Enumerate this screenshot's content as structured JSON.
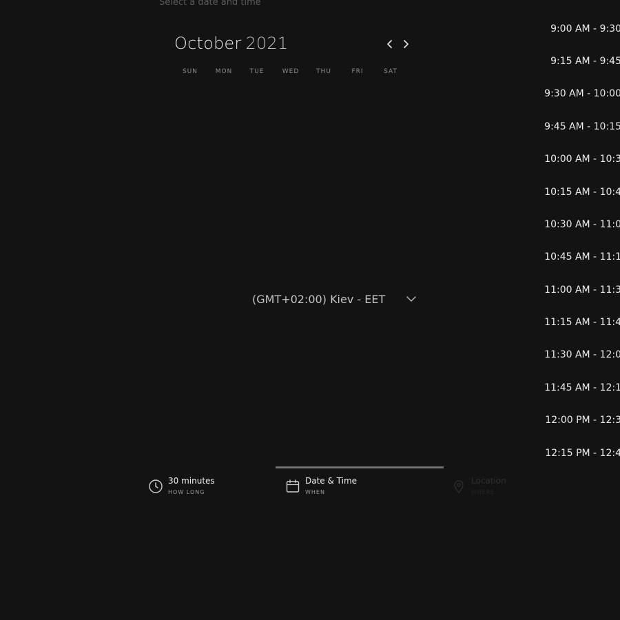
{
  "header": {
    "subtitle": "Select a date and time"
  },
  "calendar": {
    "month": "October",
    "year": "2021",
    "weekdays": [
      "SUN",
      "MON",
      "TUE",
      "WED",
      "THU",
      "FRI",
      "SAT"
    ],
    "prev_icon": "chevron-left-icon",
    "next_icon": "chevron-right-icon"
  },
  "timezone": {
    "selected": "(GMT+02:00) Kiev - EET",
    "icon": "chevron-down-icon"
  },
  "timeslots": [
    "9:00 AM - 9:30",
    "9:15 AM - 9:45",
    "9:30 AM - 10:00",
    "9:45 AM - 10:15",
    "10:00 AM - 10:3",
    "10:15 AM - 10:4",
    "10:30 AM - 11:0",
    "10:45 AM - 11:1",
    "11:00 AM - 11:3",
    "11:15 AM - 11:4",
    "11:30 AM - 12:0",
    "11:45 AM - 12:1",
    "12:00 PM - 12:3",
    "12:15 PM - 12:4"
  ],
  "steps": [
    {
      "title": "30 minutes",
      "sub": "HOW LONG",
      "icon": "clock-icon",
      "state": "active"
    },
    {
      "title": "Date & Time",
      "sub": "WHEN",
      "icon": "calendar-icon",
      "state": "active"
    },
    {
      "title": "Location",
      "sub": "WHERE",
      "icon": "location-pin-icon",
      "state": "inactive"
    }
  ],
  "colors": {
    "background": "#131313",
    "text_primary": "#ececec",
    "text_muted": "#8c8c8c",
    "progress": "#6e6e6e"
  }
}
